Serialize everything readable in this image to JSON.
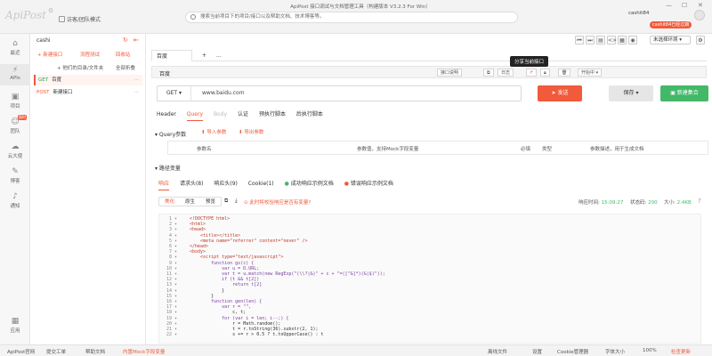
{
  "app": {
    "logo": "ApiPost",
    "window_title": "ApiPost 接口调试与文档管理工具（构建版本 V3.2.3 For Win）",
    "guest_mode": "访客/团队模式",
    "search_placeholder": "搜索当前项目下的项目/接口以及帮助文档、技术博客等。",
    "user_name": "cashit84",
    "user_badge": "cashit84已经过期",
    "win_controls": [
      "—",
      "☐",
      "✕"
    ]
  },
  "leftnav": {
    "items": [
      {
        "icon": "home-icon",
        "label": "最近"
      },
      {
        "icon": "api-icon",
        "label": "APIs"
      },
      {
        "icon": "project-icon",
        "label": "项目"
      },
      {
        "icon": "team-icon",
        "label": "团队",
        "badge": "限时"
      },
      {
        "icon": "cloud-icon",
        "label": "云大使"
      },
      {
        "icon": "blog-icon",
        "label": "博客"
      },
      {
        "icon": "bell-icon",
        "label": "通知"
      },
      {
        "icon": "apps-icon",
        "label": "应用"
      }
    ]
  },
  "tree": {
    "project": "cashi",
    "new_api": "+ 新建接口",
    "flow_test": "流程测试",
    "recycle": "回收站",
    "import_all": "+ 他们的目录/文件夹",
    "collapse_all": "全部折叠",
    "apis": [
      {
        "method": "GET",
        "name": "百度"
      },
      {
        "method": "POST",
        "name": "新建接口"
      }
    ]
  },
  "main": {
    "tabs": [
      "百度",
      "+",
      "..."
    ],
    "env_label": "未选择环境",
    "tooltip": "分享当前接口",
    "request_name": "百度",
    "req_buttons": [
      "接口说明",
      "日志",
      "分享",
      "锁定",
      "删除",
      "开始中"
    ],
    "method": "GET",
    "url": "www.baidu.com",
    "send": "发送",
    "save": "保存",
    "new_example": "新建集合",
    "subtabs": [
      "Header",
      "Query",
      "Body",
      "认证",
      "预执行脚本",
      "后执行脚本"
    ],
    "query_title": "Query参数",
    "import_params": "导入参数",
    "export_params": "导出参数",
    "param_cols": [
      "参数名",
      "参数值，支持Mock字段变量",
      "必填",
      "类型",
      "参数描述，用于生成文档"
    ],
    "response_title": "路径变量",
    "resp_tabs": [
      "响应",
      "请求头(8)",
      "响应头(9)",
      "Cookie(1)",
      "成功响应示例文档",
      "错误响应示例文档"
    ],
    "view_btns": [
      "美化",
      "原生",
      "预览"
    ],
    "warning": "此时将校验响应是否有变量?",
    "time_label": "响应时间",
    "time_value": "15:09:27",
    "status_label": "状态码",
    "status_code": "200",
    "size_label": "大小",
    "size_value": "2.4KB"
  },
  "code": {
    "lines": [
      "<!DOCTYPE html>",
      "<html>",
      "<head>",
      "    <title></title>",
      "    <meta name=\"referrer\" content=\"never\" />",
      "</head>",
      "<body>",
      "    <script type=\"text/javascript\">",
      "        function gs(c) {",
      "            var u = D.URL;",
      "            var t = u.match(new RegExp(\"(\\\\?|&)\" + c + \"=([^&]*)(&|$)\"));",
      "            if (t && t[2])",
      "                return t[2]",
      "            }",
      "        }",
      "        function gen(len) {",
      "            var r = \"\",",
      "                c, t;",
      "            for (var i = len; i--;) {",
      "                r = Math.random();",
      "                t = r.toString(36).substr(2, 1);",
      "                s += r > 0.5 ? t.toUpperCase() : t"
    ]
  },
  "statusbar": {
    "items": [
      "ApiPost官网",
      "提交工单",
      "帮助文档",
      "内置Mock字段变量",
      "离线文件",
      "设置",
      "Cookie管理器",
      "字体大小",
      "100%",
      "检查更新"
    ]
  },
  "colors": {
    "accent": "#f15a3a",
    "success": "#43b869"
  }
}
